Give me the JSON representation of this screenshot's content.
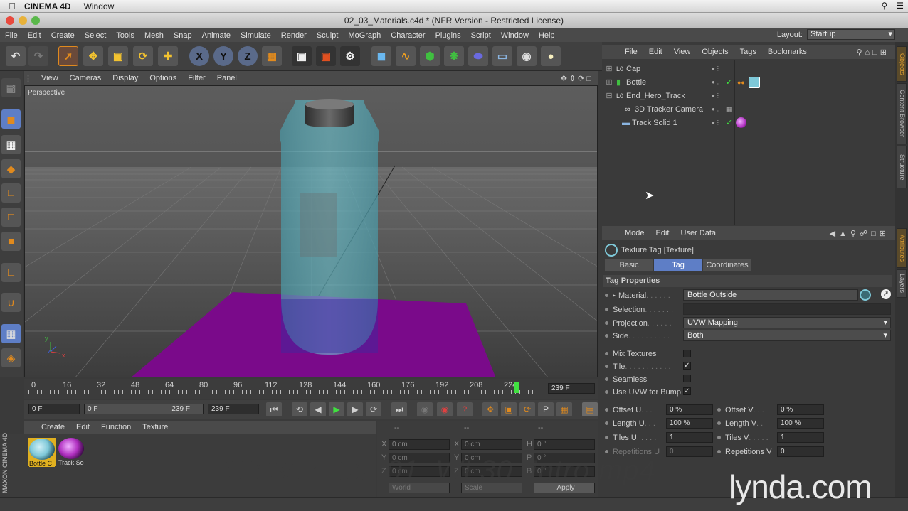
{
  "mac": {
    "app_name": "CINEMA 4D",
    "menu": [
      "Window"
    ]
  },
  "window": {
    "title": "02_03_Materials.c4d * (NFR Version - Restricted License)"
  },
  "main_menu": [
    "File",
    "Edit",
    "Create",
    "Select",
    "Tools",
    "Mesh",
    "Snap",
    "Animate",
    "Simulate",
    "Render",
    "Sculpt",
    "MoGraph",
    "Character",
    "Plugins",
    "Script",
    "Window",
    "Help"
  ],
  "layout": {
    "label": "Layout:",
    "value": "Startup"
  },
  "viewport": {
    "menu": [
      "View",
      "Cameras",
      "Display",
      "Options",
      "Filter",
      "Panel"
    ],
    "label": "Perspective"
  },
  "timeline": {
    "ticks": [
      "0",
      "16",
      "32",
      "48",
      "64",
      "80",
      "96",
      "112",
      "128",
      "144",
      "160",
      "176",
      "192",
      "208",
      "224"
    ],
    "end_frame": "239 F",
    "current_frame": "0 F",
    "range_start": "0 F",
    "range_end": "239 F",
    "max_frame": "239 F",
    "playhead_fraction": 0.953
  },
  "material_manager": {
    "menu": [
      "Create",
      "Edit",
      "Function",
      "Texture"
    ],
    "materials": [
      {
        "label": "Bottle C",
        "color": "#7ec8d8"
      },
      {
        "label": "Track So",
        "color": "#b030c0"
      }
    ]
  },
  "coord_manager": {
    "header": [
      "--",
      "--",
      "--"
    ],
    "rows": [
      {
        "a": "X",
        "av": "0 cm",
        "b": "X",
        "bv": "0 cm",
        "c": "H",
        "cv": "0 °"
      },
      {
        "a": "Y",
        "av": "0 cm",
        "b": "Y",
        "bv": "0 cm",
        "c": "P",
        "cv": "0 °"
      },
      {
        "a": "Z",
        "av": "0 cm",
        "b": "Z",
        "bv": "0 cm",
        "c": "B",
        "cv": "0 °"
      }
    ],
    "world": "World",
    "scale": "Scale",
    "apply": "Apply"
  },
  "object_manager": {
    "menu": [
      "File",
      "Edit",
      "View",
      "Objects",
      "Tags",
      "Bookmarks"
    ],
    "objects": [
      {
        "name": "Cap",
        "indent": 0,
        "icon": "null-icon"
      },
      {
        "name": "Bottle",
        "indent": 0,
        "icon": "bottle-object-icon"
      },
      {
        "name": "End_Hero_Track",
        "indent": 0,
        "icon": "null-icon"
      },
      {
        "name": "3D Tracker Camera",
        "indent": 1,
        "icon": "camera-icon"
      },
      {
        "name": "Track Solid 1",
        "indent": 1,
        "icon": "plane-icon"
      }
    ]
  },
  "attributes": {
    "menu": [
      "Mode",
      "Edit",
      "User Data"
    ],
    "title": "Texture Tag [Texture]",
    "tabs": [
      "Basic",
      "Tag",
      "Coordinates"
    ],
    "active_tab": "Tag",
    "section": "Tag Properties",
    "material_label": "Material",
    "material_value": "Bottle Outside",
    "selection_label": "Selection",
    "selection_value": "",
    "projection_label": "Projection",
    "projection_value": "UVW Mapping",
    "side_label": "Side",
    "side_value": "Both",
    "mix_label": "Mix Textures",
    "tile_label": "Tile",
    "seamless_label": "Seamless",
    "uvwbump_label": "Use UVW for Bump",
    "offset_u_label": "Offset U",
    "offset_u": "0 %",
    "offset_v_label": "Offset V",
    "offset_v": "0 %",
    "length_u_label": "Length U",
    "length_u": "100 %",
    "length_v_label": "Length V",
    "length_v": "100 %",
    "tiles_u_label": "Tiles U",
    "tiles_u": "1",
    "tiles_v_label": "Tiles V",
    "tiles_v": "1",
    "rep_u_label": "Repetitions U",
    "rep_u": "0",
    "rep_v_label": "Repetitions V",
    "rep_v": "0"
  },
  "side_tabs": {
    "top": [
      "Objects",
      "Content Browser",
      "Structure"
    ],
    "bottom": [
      "Attributes",
      "Layers"
    ]
  },
  "overlay": {
    "filename": "136357_00_01_WL30_Intro.mp4",
    "brand": "lynda.com",
    "vendor": "MAXON CINEMA 4D"
  },
  "colors": {
    "accent": "#e08a1e",
    "tab_active": "#5e7ec6",
    "plane": "#7a0a8a",
    "bottle": "#5ec8d8"
  }
}
